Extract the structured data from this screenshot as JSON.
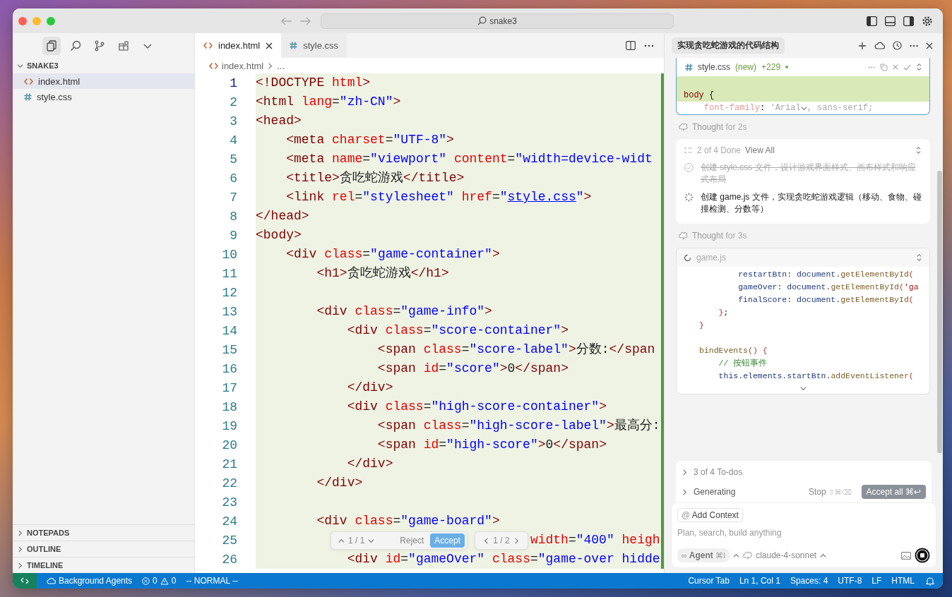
{
  "window": {
    "search": "snake3"
  },
  "sidebar": {
    "tools": [
      {
        "kind": "files",
        "selected": true
      },
      {
        "kind": "search",
        "selected": false
      },
      {
        "kind": "branch",
        "selected": false
      },
      {
        "kind": "extensions",
        "selected": false
      },
      {
        "kind": "more",
        "selected": false
      }
    ],
    "folder": {
      "name": "SNAKE3",
      "expanded": true,
      "files": [
        {
          "name": "index.html",
          "kind": "html",
          "selected": true
        },
        {
          "name": "style.css",
          "kind": "css",
          "selected": false
        }
      ]
    },
    "sections": [
      {
        "name": "NOTEPADS",
        "expanded": false
      },
      {
        "name": "OUTLINE",
        "expanded": false
      },
      {
        "name": "TIMELINE",
        "expanded": false
      }
    ]
  },
  "editor": {
    "tabs": [
      {
        "name": "index.html",
        "kind": "html",
        "selected": true
      },
      {
        "name": "style.css",
        "kind": "css",
        "selected": false
      }
    ],
    "breadcrumb": {
      "file": "index.html",
      "kind": "html",
      "rest": "..."
    },
    "changes_pending": true,
    "lines": [
      {
        "number": "1",
        "active": true,
        "text": "<!DOCTYPE html>"
      },
      {
        "number": "2",
        "active": false,
        "text": "<html lang=\"zh-CN\">"
      },
      {
        "number": "3",
        "active": false,
        "text": "<head>"
      },
      {
        "number": "4",
        "active": false,
        "text": "    <meta charset=\"UTF-8\">"
      },
      {
        "number": "5",
        "active": false,
        "text": "    <meta name=\"viewport\" content=\"width=device-widt"
      },
      {
        "number": "6",
        "active": false,
        "text": "    <title>贪吃蛇游戏</title>"
      },
      {
        "number": "7",
        "active": false,
        "text": "    <link rel=\"stylesheet\" href=\"",
        "link": "style.css",
        "after": "\">"
      },
      {
        "number": "8",
        "active": false,
        "text": "</head>"
      },
      {
        "number": "9",
        "active": false,
        "text": "<body>"
      },
      {
        "number": "10",
        "active": false,
        "text": "    <div class=\"game-container\">"
      },
      {
        "number": "11",
        "active": false,
        "text": "        <h1>贪吃蛇游戏</h1>"
      },
      {
        "number": "12",
        "active": false
      },
      {
        "number": "13",
        "active": false,
        "text": "        <div class=\"game-info\">"
      },
      {
        "number": "14",
        "active": false,
        "text": "            <div class=\"score-container\">"
      },
      {
        "number": "15",
        "active": false,
        "text": "                <span class=\"score-label\">分数:</span"
      },
      {
        "number": "16",
        "active": false,
        "text": "                <span id=\"score\">0</span>"
      },
      {
        "number": "17",
        "active": false,
        "text": "            </div>"
      },
      {
        "number": "18",
        "active": false,
        "text": "            <div class=\"high-score-container\">"
      },
      {
        "number": "19",
        "active": false,
        "text": "                <span class=\"high-score-label\">最高分:"
      },
      {
        "number": "20",
        "active": false,
        "text": "                <span id=\"high-score\">0</span>"
      },
      {
        "number": "21",
        "active": false,
        "text": "            </div>"
      },
      {
        "number": "22",
        "active": false,
        "text": "        </div>"
      },
      {
        "number": "23",
        "active": false
      },
      {
        "number": "24",
        "active": false,
        "text": "        <div class=\"game-board\">"
      },
      {
        "number": "25",
        "active": false,
        "continues_tag": true,
        "text": "                                    width=\"400\" heigh"
      },
      {
        "number": "26",
        "active": false,
        "text": "            <div id=\"gameOver\" class=\"game-over hidde"
      }
    ],
    "review": {
      "hunk": "1 / 1",
      "reject": "Reject",
      "accept": "Accept",
      "file": "1 / 2"
    }
  },
  "chat": {
    "title": "实现贪吃蛇游戏的代码结构",
    "messages": [
      {
        "kind": "diff",
        "file": "style.css",
        "status": "(new)",
        "added": "+229",
        "lines": [
          {
            "added": true
          },
          {
            "added": true,
            "parts": [
              "body {"
            ]
          },
          {
            "added": false,
            "parts": [
              "    font-family: 'Arial",
              ", sans-serif;"
            ]
          }
        ]
      },
      {
        "kind": "thought",
        "label": "Thought",
        "detail": "for 2s"
      },
      {
        "kind": "todos",
        "summary": "2 of 4 Done",
        "link": "View All",
        "items": [
          {
            "text": "创建 style.css 文件，设计游戏界面样式、画布样式和响应式布局",
            "done": true
          },
          {
            "text": "创建 game.js 文件，实现贪吃蛇游戏逻辑（移动、食物、碰撞检测、分数等）",
            "done": false
          }
        ]
      },
      {
        "kind": "thought",
        "label": "Thought",
        "detail": "for 3s"
      },
      {
        "kind": "file",
        "file": "game.js",
        "lines": [
          {
            "kind": "code",
            "text": "        restartBtn: document.getElementById("
          },
          {
            "kind": "code",
            "text": "        gameOver: document.getElementById('ga"
          },
          {
            "kind": "code",
            "text": "        finalScore: document.getElementById("
          },
          {
            "kind": "code",
            "text": "    };"
          },
          {
            "kind": "code",
            "text": "}"
          },
          {
            "kind": "blank"
          },
          {
            "kind": "code",
            "text": "bindEvents() {"
          },
          {
            "kind": "code",
            "text": "    // 按钮事件"
          },
          {
            "kind": "code",
            "text": "    this.elements.startBtn.addEventListener("
          }
        ]
      }
    ],
    "todos_summary": "3 of 4 To-dos",
    "generating": "Generating",
    "stop": "Stop",
    "stop_keys": "⇧⌘⌫",
    "accept_all": "Accept all ⌘↩",
    "add_context": {
      "icon": "@",
      "label": "Add Context"
    },
    "placeholder": "Plan, search, build anything",
    "mode": {
      "icon": "∞",
      "label": "Agent",
      "shortcut": "⌘I"
    },
    "model": "claude-4-sonnet"
  },
  "status_bar": {
    "agents": "Background Agents",
    "errors": "0",
    "warnings": "0",
    "mode": "-- NORMAL --",
    "items": [
      "Cursor Tab",
      "Ln 1, Col 1",
      "Spaces: 4",
      "UTF-8",
      "LF",
      "HTML"
    ]
  }
}
